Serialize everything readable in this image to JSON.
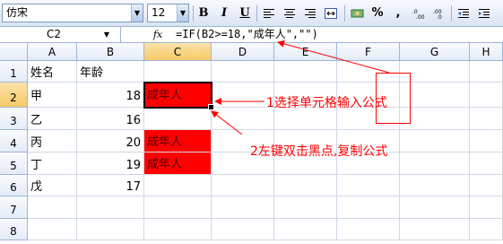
{
  "toolbar": {
    "font_name": "仿宋",
    "font_size": "12",
    "bold_label": "B",
    "italic_label": "I",
    "underline_label": "U",
    "percent_label": "%",
    "comma_label": ","
  },
  "formula_bar": {
    "name_box": "C2",
    "fx_label": "fx",
    "formula": "=IF(B2>=18,\"成年人\",\"\")"
  },
  "columns": [
    "A",
    "B",
    "C",
    "D",
    "E",
    "F",
    "G",
    "H"
  ],
  "rows": [
    {
      "num": "1",
      "A": "姓名",
      "B": "年龄",
      "C": ""
    },
    {
      "num": "2",
      "A": "甲",
      "B": "18",
      "C": "成年人"
    },
    {
      "num": "3",
      "A": "乙",
      "B": "16",
      "C": ""
    },
    {
      "num": "4",
      "A": "丙",
      "B": "20",
      "C": "成年人"
    },
    {
      "num": "5",
      "A": "丁",
      "B": "19",
      "C": "成年人"
    },
    {
      "num": "6",
      "A": "戊",
      "B": "17",
      "C": ""
    },
    {
      "num": "7",
      "A": "",
      "B": "",
      "C": ""
    },
    {
      "num": "8",
      "A": "",
      "B": "",
      "C": ""
    }
  ],
  "annotations": {
    "step1_prefix": "1选择单元格输入",
    "step1_boxed": "公式",
    "step2": "2左键双击黑点,复制公式"
  },
  "colors": {
    "highlight": "#ff0000",
    "annotation": "#ff0000",
    "active_header": "#f8c968"
  }
}
